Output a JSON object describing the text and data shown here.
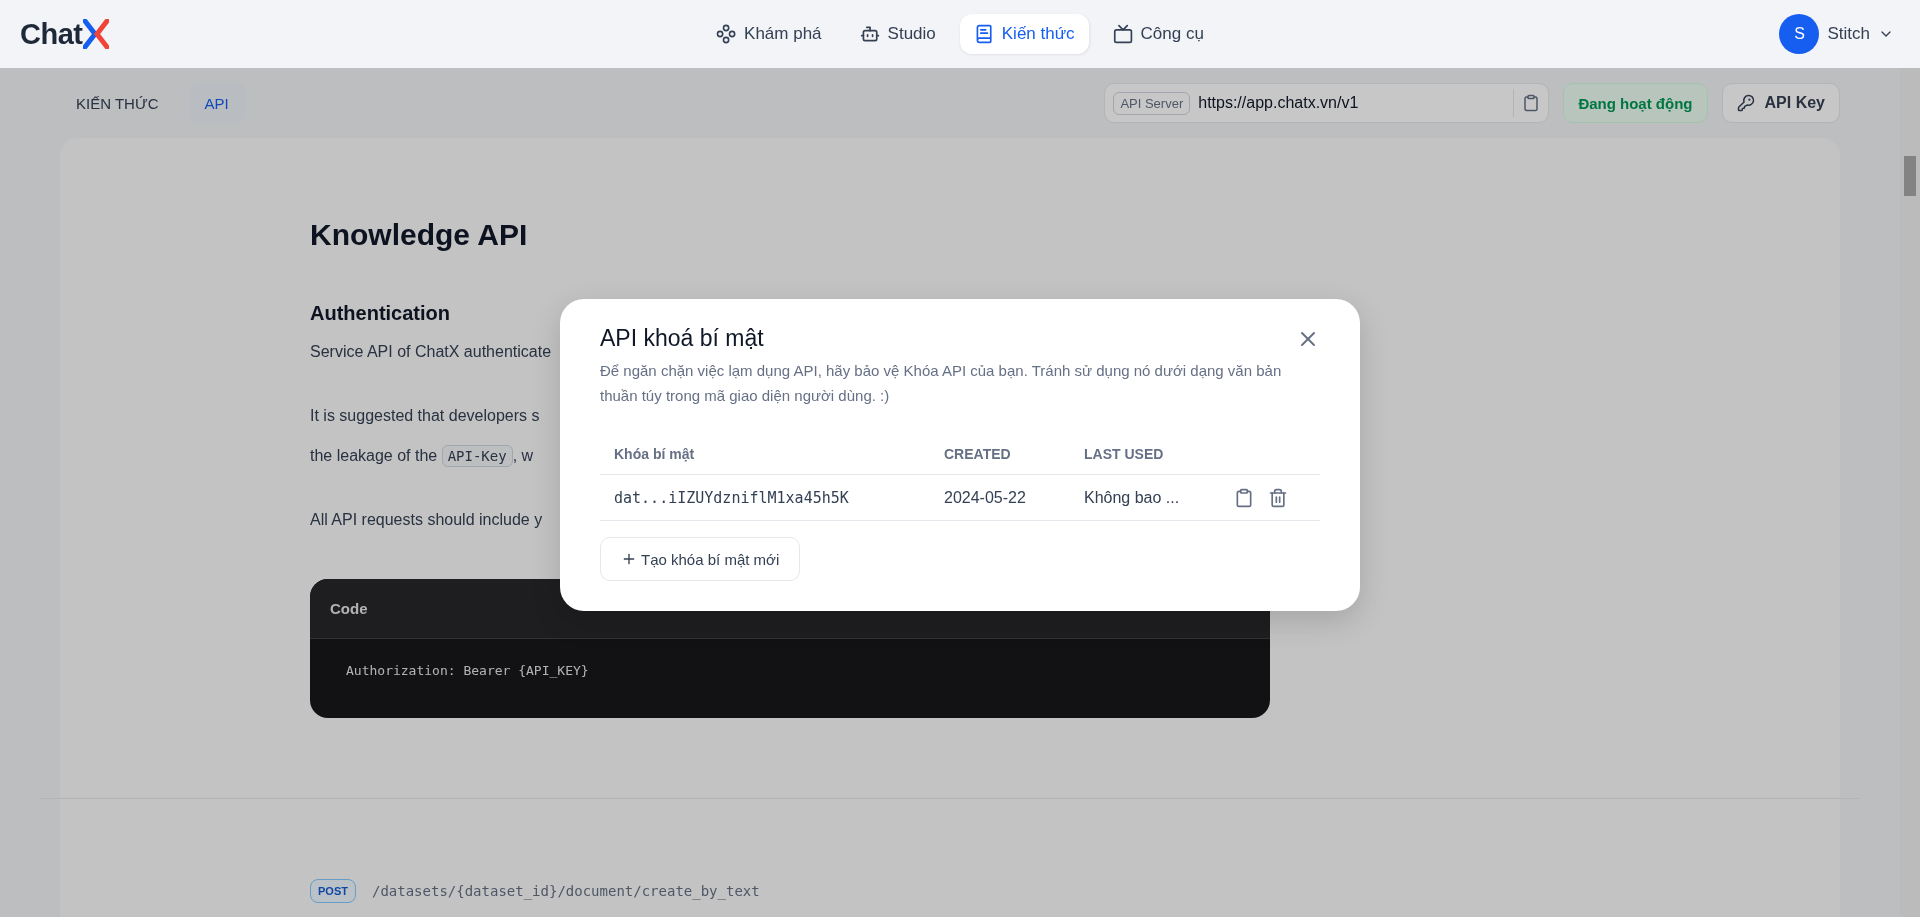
{
  "header": {
    "logo_text": "Chat",
    "nav": [
      {
        "label": "Khám phá",
        "selected": false
      },
      {
        "label": "Studio",
        "selected": false
      },
      {
        "label": "Kiến thức",
        "selected": true
      },
      {
        "label": "Công cụ",
        "selected": false
      }
    ],
    "user": {
      "initial": "S",
      "name": "Stitch"
    }
  },
  "subheader": {
    "tabs": [
      {
        "label": "KIẾN THỨC",
        "selected": false
      },
      {
        "label": "API",
        "selected": true
      }
    ],
    "api_server": {
      "label": "API Server",
      "url": "https://app.chatx.vn/v1"
    },
    "status": "Đang hoạt động",
    "api_key_button": "API Key"
  },
  "doc": {
    "title": "Knowledge API",
    "section_title": "Authentication",
    "lines": [
      {
        "kind": "text",
        "text": "Service API of ChatX authenticate"
      },
      {
        "kind": "text",
        "text": "It is suggested that developers s"
      },
      {
        "kind": "code",
        "before": "the leakage of the ",
        "code": "API-Key",
        "after": ", w"
      },
      {
        "kind": "text",
        "text": "All API requests should include y"
      }
    ],
    "code_block": {
      "title": "Code",
      "content": "Authorization: Bearer {API_KEY}"
    },
    "endpoint": {
      "method": "POST",
      "path": "/datasets/{dataset_id}/document/create_by_text"
    }
  },
  "modal": {
    "title": "API khoá bí mật",
    "description": "Để ngăn chặn việc lạm dụng API, hãy bảo vệ Khóa API của bạn. Tránh sử dụng nó dưới dạng văn bản thuần túy trong mã giao diện người dùng. :)",
    "columns": [
      "Khóa bí mật",
      "CREATED",
      "LAST USED"
    ],
    "rows": [
      {
        "key": "dat...iIZUYdzniflM1xa45h5K",
        "created": "2024-05-22",
        "last_used": "Không bao ..."
      }
    ],
    "create_button": "Tạo khóa bí mật mới"
  }
}
